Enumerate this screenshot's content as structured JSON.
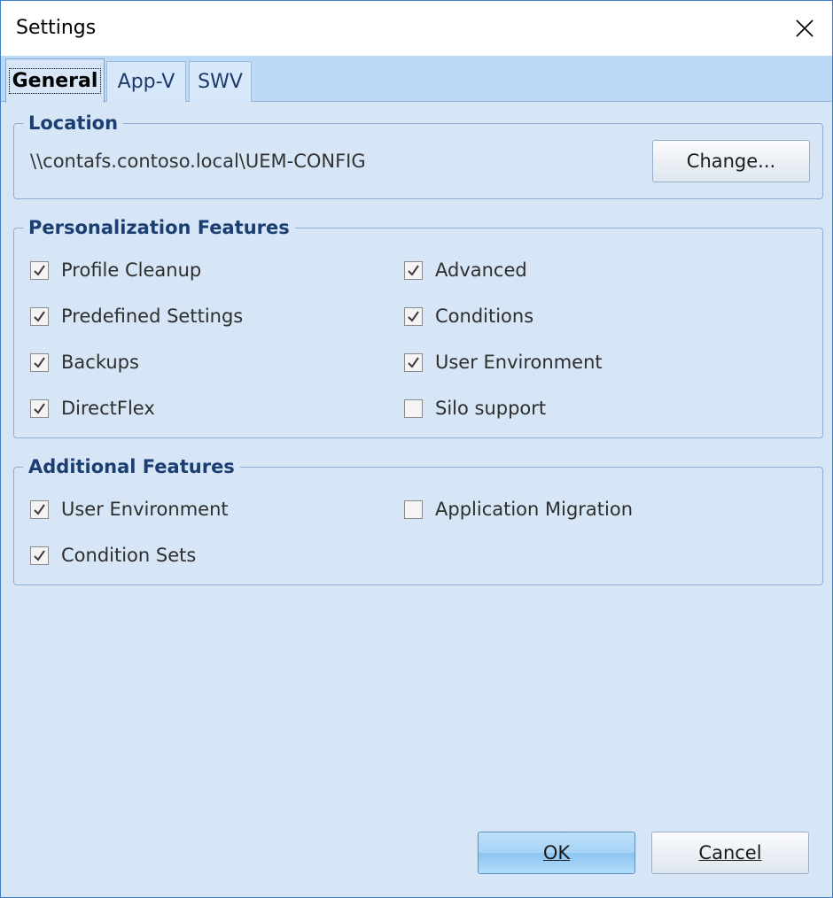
{
  "window": {
    "title": "Settings"
  },
  "tabs": [
    {
      "label": "General",
      "active": true
    },
    {
      "label": "App-V",
      "active": false
    },
    {
      "label": "SWV",
      "active": false
    }
  ],
  "location": {
    "legend": "Location",
    "path": "\\\\contafs.contoso.local\\UEM-CONFIG",
    "change_button": "Change..."
  },
  "personalization": {
    "legend": "Personalization Features",
    "items": [
      {
        "label": "Profile Cleanup",
        "checked": true
      },
      {
        "label": "Predefined Settings",
        "checked": true
      },
      {
        "label": "Backups",
        "checked": true
      },
      {
        "label": "DirectFlex",
        "checked": true
      },
      {
        "label": "Advanced",
        "checked": true
      },
      {
        "label": "Conditions",
        "checked": true
      },
      {
        "label": "User Environment",
        "checked": true
      },
      {
        "label": "Silo support",
        "checked": false
      }
    ]
  },
  "additional": {
    "legend": "Additional Features",
    "items": [
      {
        "label": "User Environment",
        "checked": true
      },
      {
        "label": "Condition Sets",
        "checked": true
      },
      {
        "label": "Application Migration",
        "checked": false
      }
    ]
  },
  "footer": {
    "ok_label": "OK",
    "cancel_label": "Cancel"
  },
  "colors": {
    "background": "#d6e6f6",
    "tabstrip": "#bcd9f7",
    "legend_text": "#1b3f72",
    "check_mark": "#3a3a3a"
  }
}
